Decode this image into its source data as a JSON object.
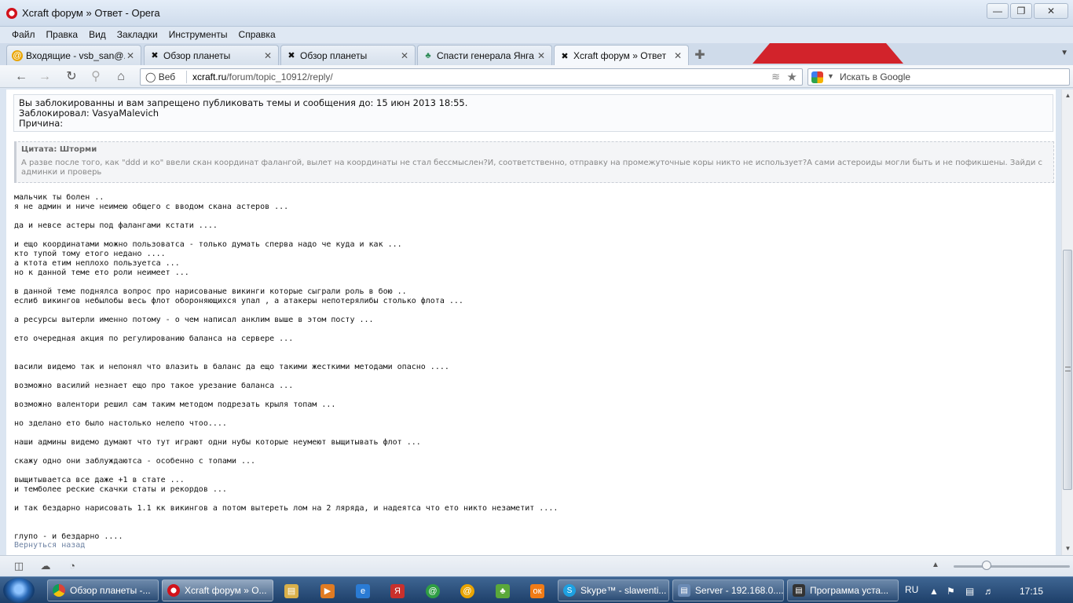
{
  "window": {
    "title": "Xcraft форум » Ответ - Opera"
  },
  "menu": [
    "Файл",
    "Правка",
    "Вид",
    "Закладки",
    "Инструменты",
    "Справка"
  ],
  "tabs": [
    {
      "label": "Входящие - vsb_san@...",
      "icon": "mail-icon"
    },
    {
      "label": "Обзор планеты",
      "icon": "xcraft-icon"
    },
    {
      "label": "Обзор планеты",
      "icon": "xcraft-icon"
    },
    {
      "label": "Спасти генерала Янга ...",
      "icon": "game-icon"
    },
    {
      "label": "Xcraft форум » Ответ",
      "icon": "xcraft-icon",
      "active": true
    }
  ],
  "address": {
    "web_label": "Веб",
    "url_host": "xcraft.ru",
    "url_path": "/forum/topic_10912/reply/"
  },
  "search": {
    "placeholder": "Искать в Google"
  },
  "ban": {
    "line1": "Вы заблокированны и вам запрещено публиковать темы и сообщения до: 15 июн 2013 18:55.",
    "line2": "Заблокировал: VasyaMalevich",
    "line3": "Причина:"
  },
  "quote": {
    "header": "Цитата: Шторми",
    "body": "А разве после того, как \"ddd и ко\" ввели скан координат фалангой, вылет на координаты не стал бессмыслен?И, соответственно, отправку на промежуточные коры никто не использует?А сами астероиды могли быть и не пофикшены. Зайди с админки и проверь"
  },
  "message_lines": [
    "мальчик ты болен ..",
    "я не админ и ниче неимею общего с вводом скана астеров ...",
    "",
    "да и невсе астеры под фалангами кстати ....",
    "",
    "и ещо координатами можно пользоватса - только думать сперва надо че куда и как ...",
    "кто тупой тому етого недано ....",
    "а ктота етим неплохо пользуетса ...",
    "но к данной теме ето роли неимеет ...",
    "",
    "в данной теме поднялса вопрос про нарисованые викинги которые сыграли роль в бою ..",
    "еслиб викингов небылобы весь флот обороняющихся упал , а атакеры непотерялибы столько флота ...",
    "",
    "а ресурсы вытерли именно потому - о чем написал анклим выше в этом посту ...",
    "",
    "ето очередная акция по регулированию баланса на сервере ...",
    "",
    "",
    "васили видемо так и непонял что влазить в баланс да ещо такими жесткими методами опасно ....",
    "",
    "возможно василий незнает ещо про такое урезание баланса ...",
    "",
    "возможно валентори решил сам таким методом подрезать крыля топам ...",
    "",
    "но зделано ето было настолько нелепо чтоо....",
    "",
    "наши админы видемо думают что тут играют одни нубы которые неумеют выщитывать флот ...",
    "",
    "скажу одно они заблуждаютса - особенно с топами ...",
    "",
    "выщитываетса все даже +1 в стате ...",
    "и темболее реские скачки статы и рекордов ...",
    "",
    "и так бездарно нарисовать 1.1 кк викингов а потом вытереть лом на 2 ляряда, и надеятса что ето никто незаметит ....",
    "",
    "",
    "глупо - и бездарно ...."
  ],
  "back_link": "Вернуться назад",
  "taskbar": {
    "items": [
      {
        "label": "Обзор планеты -...",
        "icon": "chrome-icon"
      },
      {
        "label": "Xcraft форум » О...",
        "icon": "opera-icon",
        "active": true
      },
      {
        "label": "Skype™ - slawenti...",
        "icon": "skype-icon"
      },
      {
        "label": "Server - 192.168.0....",
        "icon": "server-icon"
      },
      {
        "label": "Программа уста...",
        "icon": "installer-icon"
      }
    ],
    "lang": "RU",
    "time": "17:15"
  },
  "colors": {
    "opera_red": "#d2121b",
    "taskbar": "#2a4d7a",
    "link": "#6d82a3"
  }
}
